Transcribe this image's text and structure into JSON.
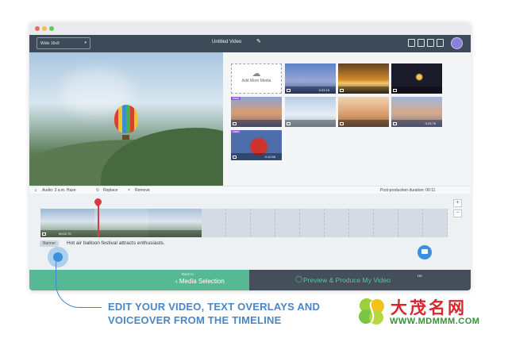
{
  "header": {
    "aspect_ratio_value": "Wide 16x9",
    "video_title": "Untitled Video",
    "pencil_glyph": "✎"
  },
  "media_panel": {
    "add_media_label": "Add More Media",
    "thumbnails": [
      {
        "duration": "0:23.18"
      },
      {
        "duration": ""
      },
      {
        "duration": ""
      },
      {
        "tag": "Used",
        "duration": ""
      },
      {
        "duration": ""
      },
      {
        "duration": ""
      },
      {
        "duration": "0:23.76"
      },
      {
        "tag": "Used",
        "duration": "0:10.56"
      }
    ]
  },
  "audio_bar": {
    "audio_label": "Audio: 3 a.m. Haze",
    "replace_label": "Replace",
    "remove_label": "Remove",
    "duration_label": "Post-production duration: 00:11"
  },
  "timeline": {
    "clip_duration": "00:02.70",
    "zoom_in": "+",
    "zoom_out": "−",
    "overlay_pill": "Banner",
    "overlay_text": "Hot air balloon festival attracts enthusiasts."
  },
  "footer": {
    "back_small": "Back to",
    "back_label": "‹ Media Selection",
    "produce_label": "Preview & Produce My Video",
    "hd_badge": "HD"
  },
  "caption": {
    "line1": "EDIT YOUR VIDEO, TEXT OVERLAYS AND",
    "line2": "VOICEOVER FROM THE TIMELINE"
  },
  "brand": {
    "name": "大茂名网",
    "url": "WWW.MDMMM.COM"
  },
  "colors": {
    "topbar": "#3d4a57",
    "footer_green": "#57b896",
    "footer_dark": "#444f5b",
    "accent_blue": "#4a86c6",
    "playhead_red": "#d93a45"
  }
}
